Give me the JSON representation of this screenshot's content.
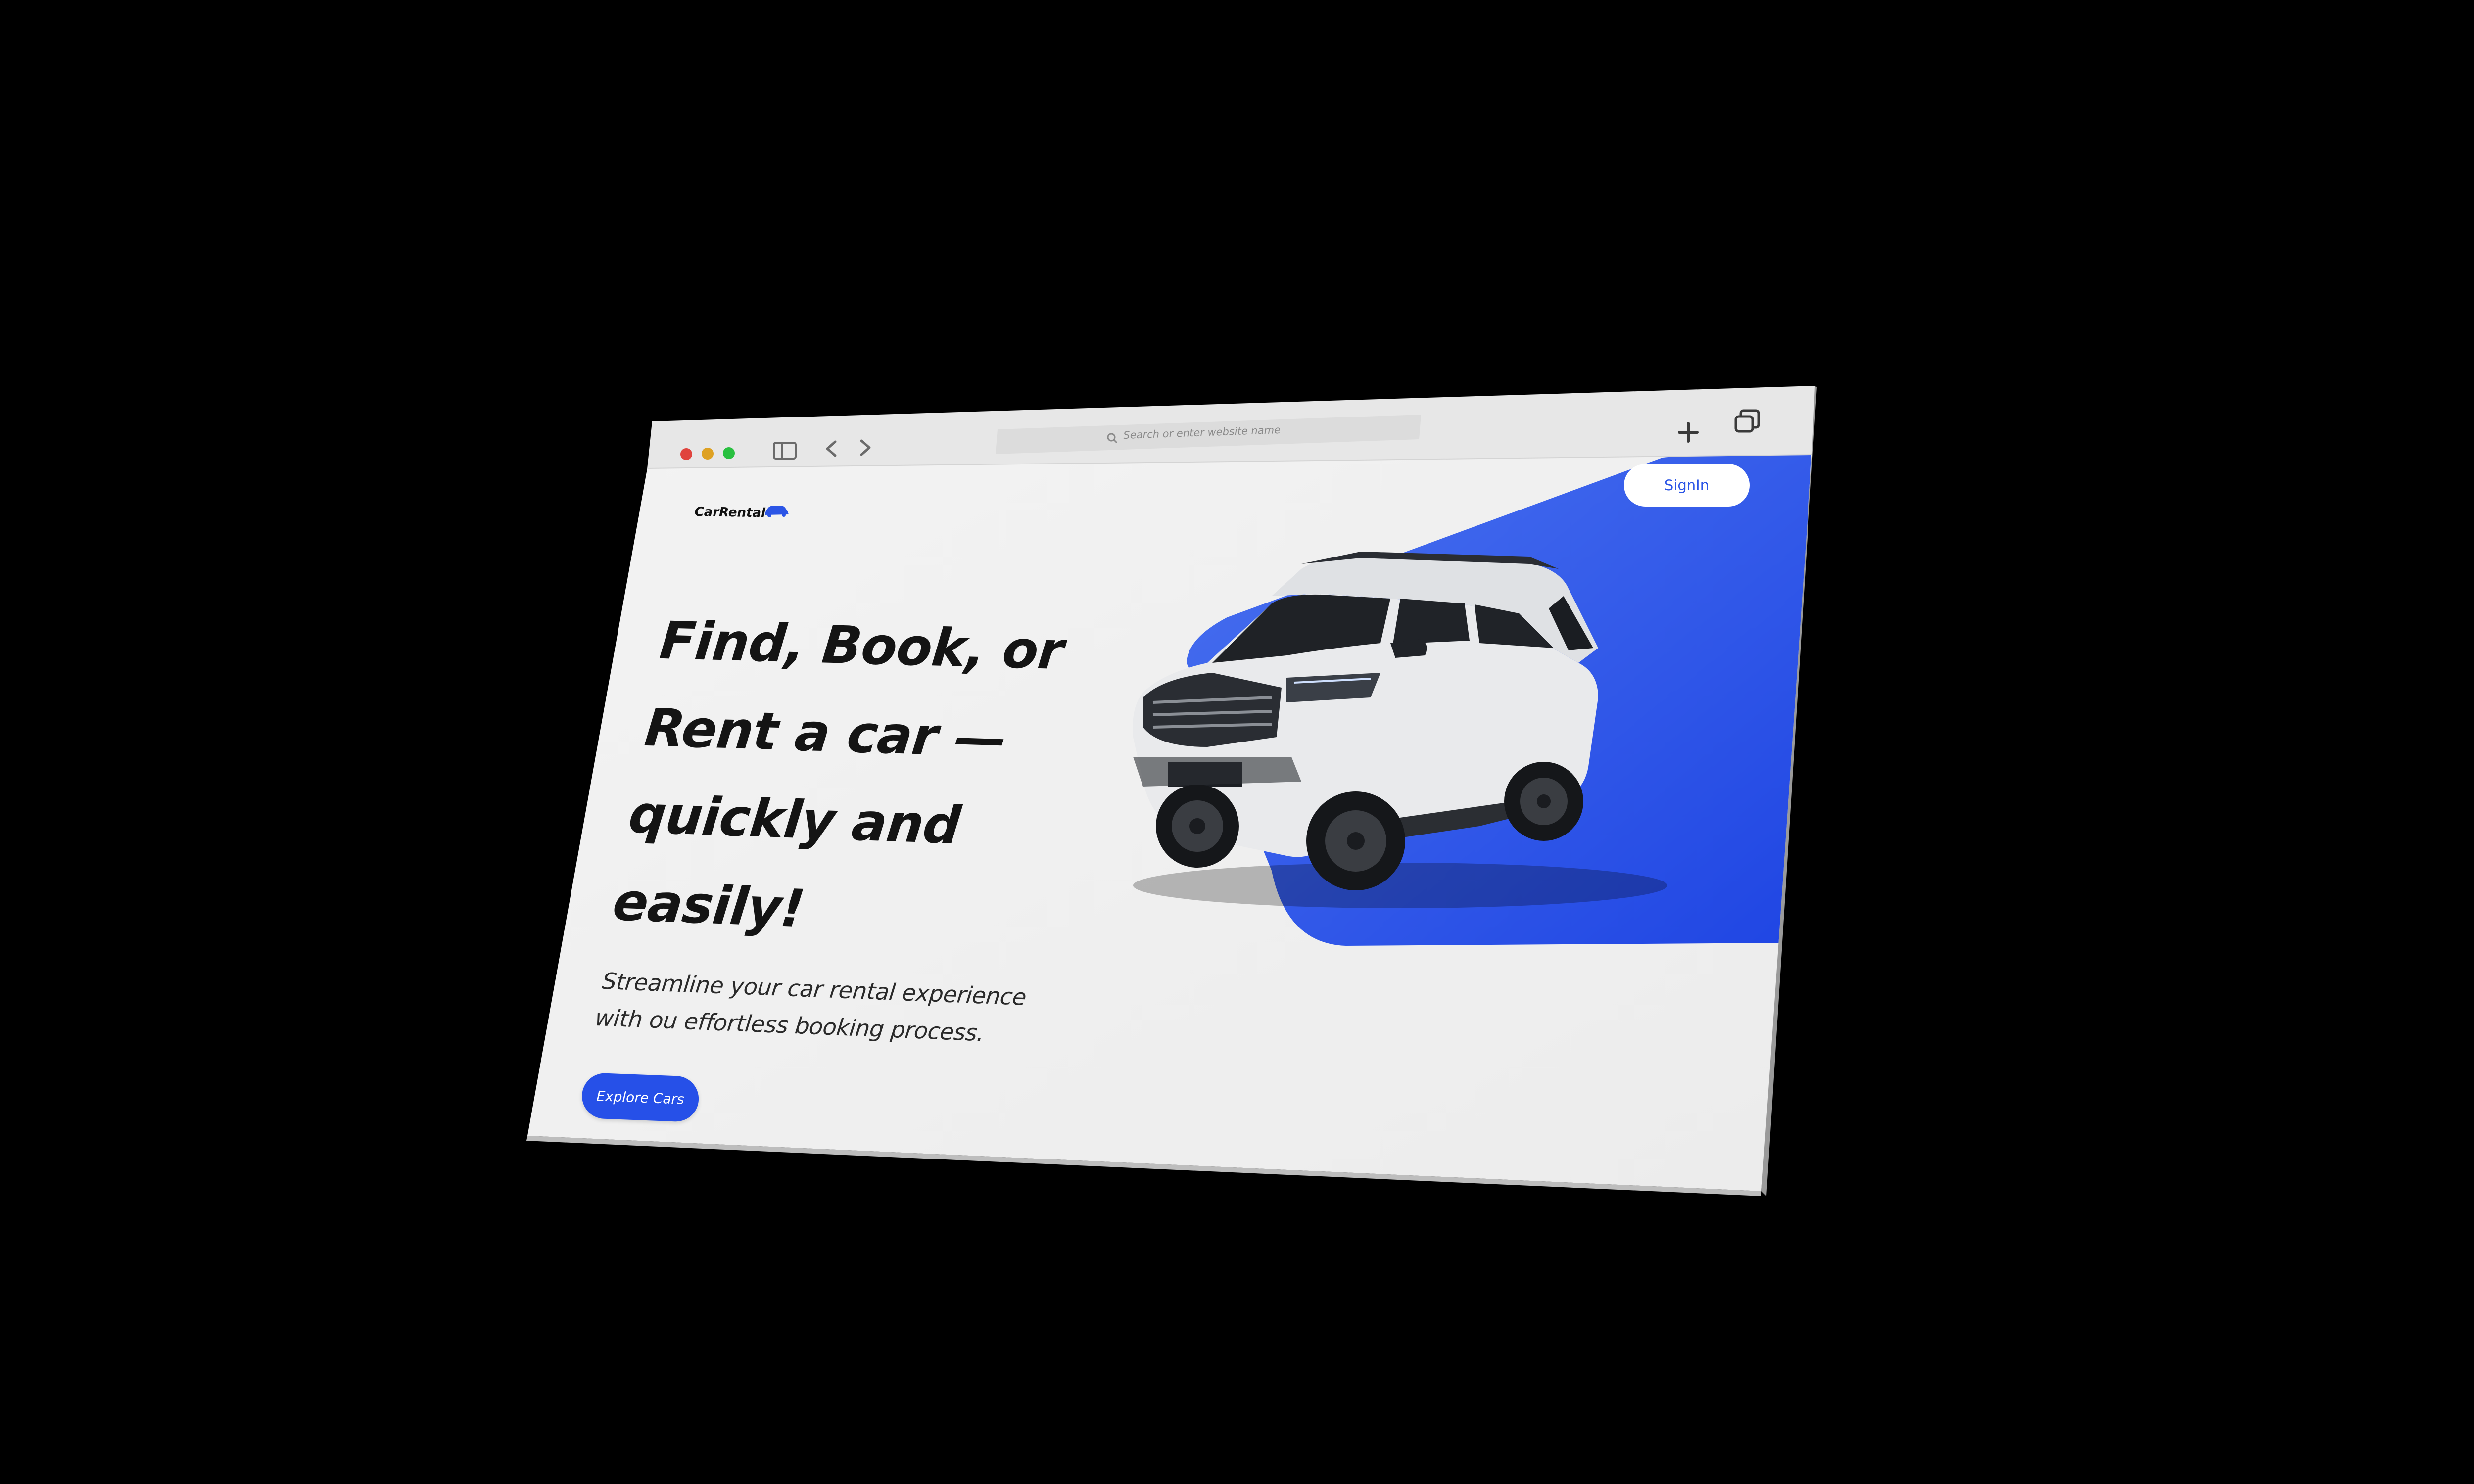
{
  "browser": {
    "address_placeholder": "Search or enter website name",
    "icons": [
      "close-dot",
      "minimize-dot",
      "maximize-dot",
      "sidebar-icon",
      "back-chevron-icon",
      "forward-chevron-icon",
      "search-icon",
      "new-tab-plus-icon",
      "tabs-overview-icon"
    ],
    "dot_colors": [
      "#e0443e",
      "#dea123",
      "#29c040"
    ]
  },
  "site": {
    "brand": "CarRental",
    "brand_icon": "car-icon",
    "signin_label": "SignIn",
    "headline_lines": [
      "Find, Book, or",
      "Rent a car —",
      "quickly and",
      "easily!"
    ],
    "subtitle_lines": [
      "Streamline your car rental experience",
      "with ou effortless booking process."
    ],
    "cta_label": "Explore Cars",
    "hero_image": "white-suv-photo",
    "accent_color": "#2b55e6"
  }
}
